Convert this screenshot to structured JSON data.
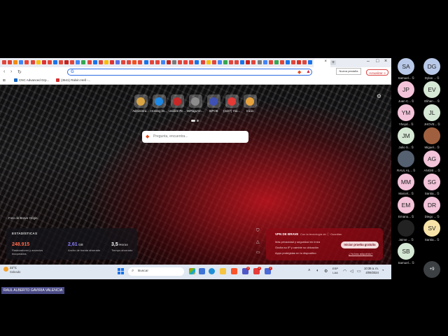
{
  "browser": {
    "tab_colors": [
      "#e0463c",
      "#dd4433",
      "#f28b12",
      "#4285f4",
      "#ea4335",
      "#e0463c",
      "#fbbc05",
      "#dd3333",
      "#e0463c",
      "#1a73e8",
      "#e0463c",
      "#c5221f",
      "#e0463c",
      "#4285f4",
      "#34a853",
      "#e0463c",
      "#1a73e8",
      "#e0463c",
      "#fbbc05",
      "#dd3333",
      "#5b6ee1",
      "#e0463c",
      "#e0463c",
      "#f4511e",
      "#e0463c",
      "#1a73e8",
      "#e0463c",
      "#e0463c",
      "#4285f4",
      "#c5221f",
      "#7a7a7a",
      "#e0463c",
      "#e0463c",
      "#ea4335",
      "#1a73e8",
      "#e0463c",
      "#fbbc05",
      "#e0463c",
      "#4285f4",
      "#34a853",
      "#e0463c",
      "#e0463c",
      "#1a73e8",
      "#c5221f",
      "#e0463c",
      "#7a7a7a",
      "#4285f4",
      "#e0463c",
      "#34a853",
      "#e0463c",
      "#1a73e8",
      "#e0463c",
      "#d93025",
      "#e0463c",
      "#1a73e8"
    ],
    "new_tab_tooltip": "Nueva pestaña",
    "update_button": "Actualizar",
    "address_value": "",
    "bookmarks": [
      {
        "label": "CNC Advanced Grp...",
        "color": "#1565c0"
      },
      {
        "label": "(3541) Ralvin Hell -...",
        "color": "#d32f2f"
      }
    ]
  },
  "ntp": {
    "top_sites": [
      {
        "label": "Administra...",
        "color": "#d9a441"
      },
      {
        "label": "Hosting en...",
        "color": "#1e88e5"
      },
      {
        "label": "Unilibre Pe...",
        "color": "#c62828"
      },
      {
        "label": "MiPagoAm...",
        "color": "#8c8c8c"
      },
      {
        "label": "SIPOB",
        "color": "#3f51b5"
      },
      {
        "label": "(4427) You...",
        "color": "#e53935"
      },
      {
        "label": "Inicio",
        "color": "#e8a33c"
      }
    ],
    "search_placeholder": "Pregunta, encuentra...",
    "photo_credit": "Foto de Brave Origin",
    "stats": {
      "title": "ESTADÍSTICAS",
      "blocked_value": "248.915",
      "blocked_desc": "Rastreadores y anuncios bloqueados",
      "bandwidth_value": "2,61",
      "bandwidth_unit": "GB",
      "bandwidth_desc": "Ancho de banda ahorrado",
      "time_value": "3,5",
      "time_unit": "Horas",
      "time_desc": "Tiempo ahorrado"
    },
    "vpn": {
      "title": "VPN DE BRAVE",
      "subtitle": "Con la tecnología de ⓘ Guardian",
      "features": [
        "Más privacidad y seguridad en línea",
        "Oculta su IP y cambie su ubicación",
        "Apps protegidas en tu dispositivo"
      ],
      "cta": "Iniciar prueba gratuita",
      "link": "¿Ya has adquirido?"
    }
  },
  "taskbar": {
    "temperature": "22°C",
    "condition": "Soleado",
    "search_label": "Buscar",
    "lang_line1": "ESP",
    "lang_line2": "LAA",
    "time": "10:39 a. m.",
    "date": "4/09/2024",
    "badges": [
      "9",
      "2",
      "2"
    ]
  },
  "participants": [
    {
      "initials": "SA",
      "name": "Samuel...",
      "color": "#b8c8e8"
    },
    {
      "initials": "DG",
      "name": "Dylan ...",
      "color": "#b8c8e8"
    },
    {
      "initials": "JP",
      "name": "Juan C...",
      "color": "#f3c3d9"
    },
    {
      "initials": "EV",
      "name": "Elihan ...",
      "color": "#d5e8d4"
    },
    {
      "initials": "YM",
      "name": "Yheyd...",
      "color": "#f3c3d9"
    },
    {
      "initials": "JL",
      "name": "JHOVE...",
      "color": "#d5e8d4"
    },
    {
      "initials": "JM",
      "name": "Julio S...",
      "color": "#d5e8d4"
    },
    {
      "initials": "",
      "name": "Miguel...",
      "color": "#a06040"
    },
    {
      "initials": "",
      "name": "RAUL AL...",
      "color": "#556070"
    },
    {
      "initials": "AG",
      "name": "ANGIE ...",
      "color": "#f3c3d9"
    },
    {
      "initials": "MM",
      "name": "Marcel...",
      "color": "#f3c3d9"
    },
    {
      "initials": "SG",
      "name": "Santia...",
      "color": "#f3c3d9"
    },
    {
      "initials": "EM",
      "name": "Emanu...",
      "color": "#f3c3d9"
    },
    {
      "initials": "DR",
      "name": "Diego ...",
      "color": "#f3c3d9"
    },
    {
      "initials": "",
      "name": "Jaime ...",
      "color": "#222222"
    },
    {
      "initials": "SV",
      "name": "Santia...",
      "color": "#f7e3a8"
    },
    {
      "initials": "SB",
      "name": "Samuel...",
      "color": "#d5e8d4"
    }
  ],
  "more_participants": "+9",
  "presenter_name": "RAUL ALBERTO GAVIRIA VALENCIA"
}
